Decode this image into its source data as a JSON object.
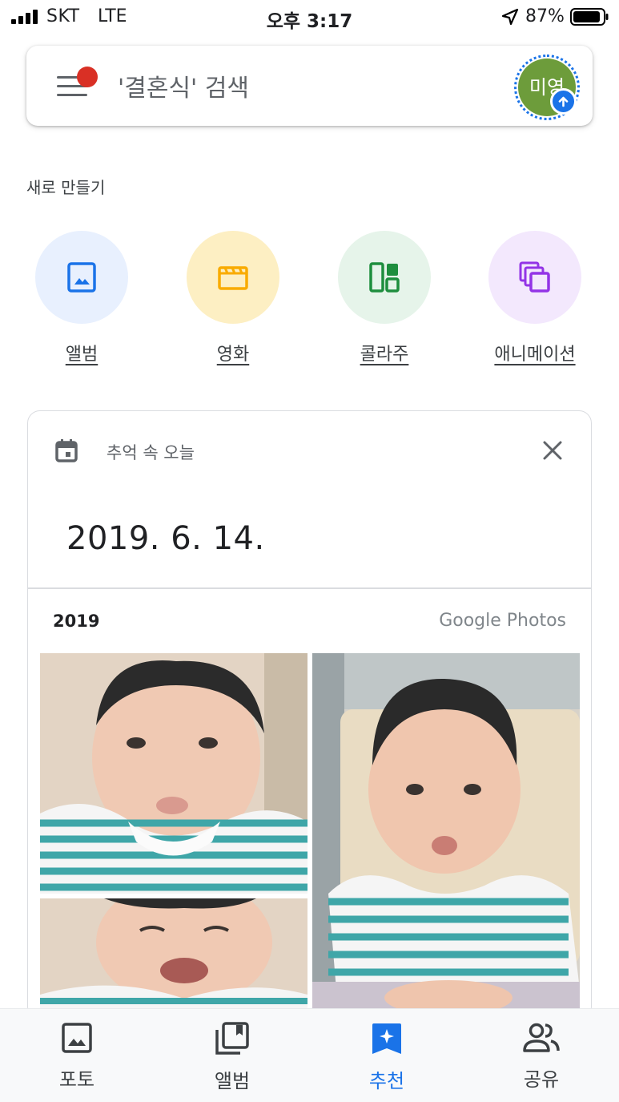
{
  "status_bar": {
    "carrier": "SKT",
    "network": "LTE",
    "time": "오후 3:17",
    "battery": "87%"
  },
  "search": {
    "placeholder": "'결혼식' 검색",
    "avatar_initials": "미영",
    "icons": [
      "menu-icon",
      "notification-dot",
      "upload-icon"
    ]
  },
  "create": {
    "section_label": "새로 만들기",
    "items": [
      {
        "label": "앨범",
        "icon": "album-icon",
        "bg_color": "#e8f0fe",
        "icon_color": "#1a73e8"
      },
      {
        "label": "영화",
        "icon": "movie-icon",
        "bg_color": "#fdefc3",
        "icon_color": "#f9ab00"
      },
      {
        "label": "콜라주",
        "icon": "collage-icon",
        "bg_color": "#e6f4ea",
        "icon_color": "#1e8e3e"
      },
      {
        "label": "애니메이션",
        "icon": "animation-icon",
        "bg_color": "#f3e8fd",
        "icon_color": "#9334e6"
      }
    ]
  },
  "memory": {
    "title": "추억 속 오늘",
    "date": "2019. 6. 14.",
    "year": "2019",
    "brand": "Google Photos",
    "photo_count": 3
  },
  "bottom_nav": [
    {
      "label": "포토",
      "icon": "photos-icon",
      "active": false
    },
    {
      "label": "앨범",
      "icon": "albums-icon",
      "active": false
    },
    {
      "label": "추천",
      "icon": "recommend-icon",
      "active": true
    },
    {
      "label": "공유",
      "icon": "sharing-icon",
      "active": false
    }
  ],
  "colors": {
    "accent": "#1a73e8",
    "notification": "#d93025",
    "avatar_bg": "#6d9c3b"
  }
}
